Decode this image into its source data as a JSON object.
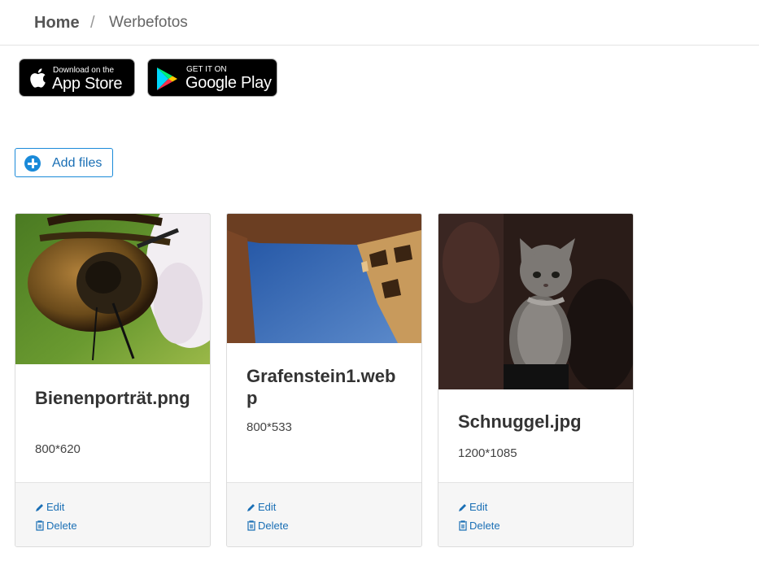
{
  "breadcrumb": {
    "home": "Home",
    "separator": "/",
    "current": "Werbefotos"
  },
  "app_store": {
    "line1": "Download on the",
    "line2": "App Store"
  },
  "google_play": {
    "line1": "GET IT ON",
    "line2": "Google Play"
  },
  "add_files": {
    "label": "Add files",
    "accent": "#1a8ad9"
  },
  "cards": [
    {
      "title": "Bienenporträt.png",
      "dimensions": "800*620",
      "edit_label": "Edit",
      "delete_label": "Delete"
    },
    {
      "title": "Grafenstein1.webp",
      "dimensions": "800*533",
      "edit_label": "Edit",
      "delete_label": "Delete"
    },
    {
      "title": "Schnuggel.jpg",
      "dimensions": "1200*1085",
      "edit_label": "Edit",
      "delete_label": "Delete"
    }
  ]
}
